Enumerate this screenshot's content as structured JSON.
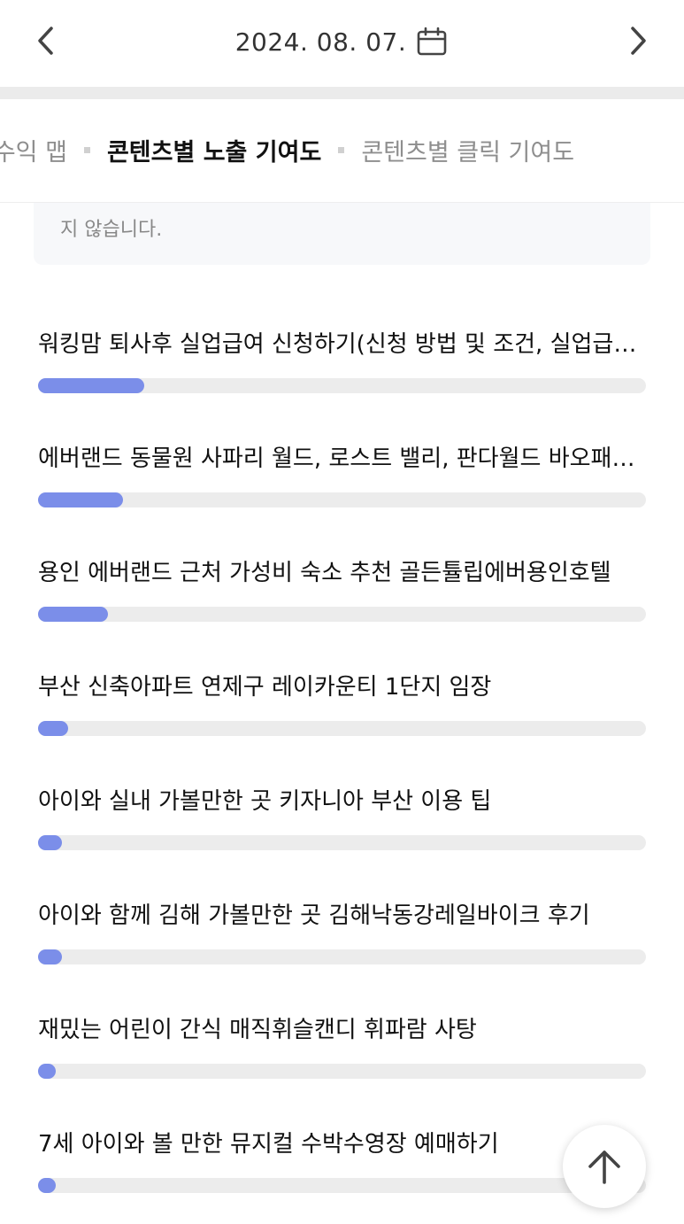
{
  "header": {
    "date": "2024. 08. 07.",
    "prev_icon": "chevron-left-icon",
    "next_icon": "chevron-right-icon",
    "calendar_icon": "calendar-icon"
  },
  "tabs": [
    {
      "label": "광수익 맵",
      "active": false
    },
    {
      "label": "콘텐츠별 노출 기여도",
      "active": true
    },
    {
      "label": "콘텐츠별 클릭 기여도",
      "active": false
    }
  ],
  "notice": {
    "text": "지 않습니다."
  },
  "items": [
    {
      "title": "워킹맘 퇴사후 실업급여 신청하기(신청 방법 및 조건, 실업급여 계산)",
      "progress": 0.175
    },
    {
      "title": "에버랜드 동물원 사파리 월드, 로스트 밸리, 판다월드 바오패밀리",
      "progress": 0.14
    },
    {
      "title": "용인 에버랜드 근처 가성비 숙소 추천 골든튤립에버용인호텔",
      "progress": 0.115
    },
    {
      "title": "부산 신축아파트 연제구 레이카운티 1단지 임장",
      "progress": 0.05
    },
    {
      "title": "아이와 실내 가볼만한 곳 키자니아 부산 이용 팁",
      "progress": 0.04
    },
    {
      "title": "아이와 함께 김해 가볼만한 곳 김해낙동강레일바이크 후기",
      "progress": 0.04
    },
    {
      "title": "재밌는 어린이 간식 매직휘슬캔디 휘파람 사탕",
      "progress": 0.025
    },
    {
      "title": "7세 아이와 볼 만한 뮤지컬 수박수영장 예매하기",
      "progress": 0.025
    }
  ],
  "scroll_top_icon": "arrow-up-icon",
  "colors": {
    "accent": "#7b8ee9",
    "track": "#ececec"
  }
}
